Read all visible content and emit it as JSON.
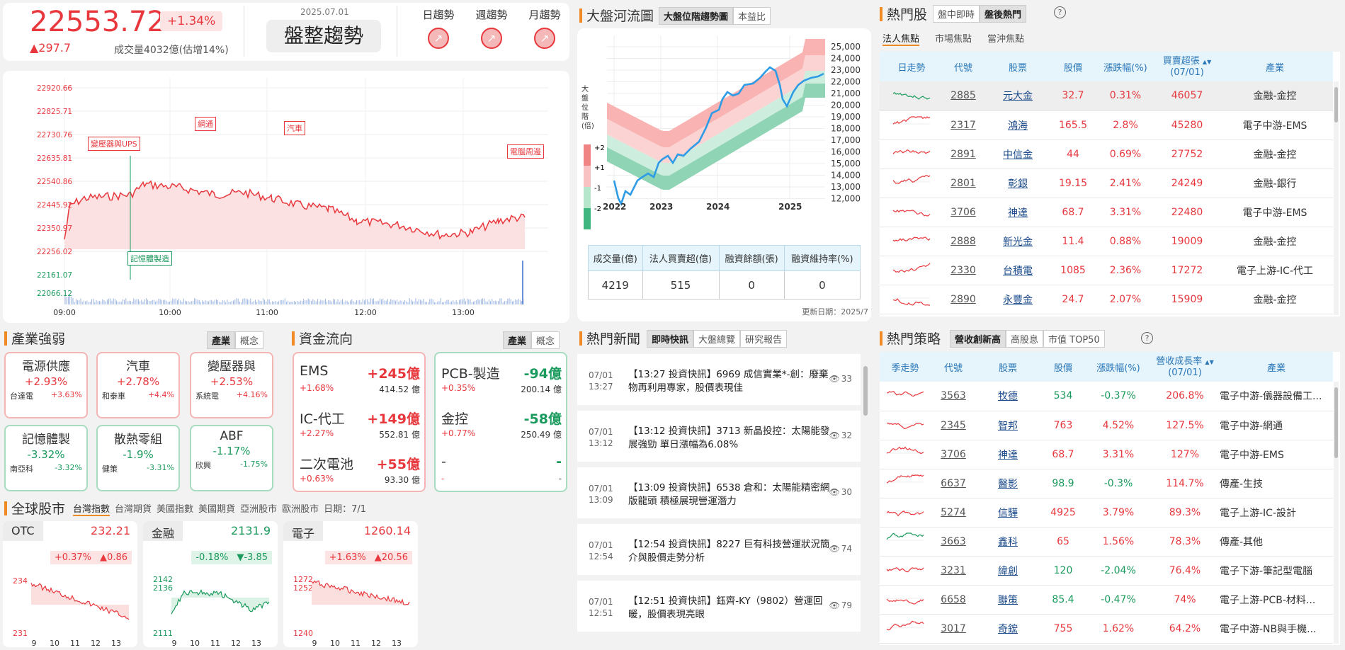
{
  "index": {
    "value": "22553.72",
    "pct": "+1.34%",
    "chg": "▲297.7",
    "volume": "成交量4032億(估增14%)",
    "date": "2025.07.01",
    "trend": "盤整趨勢",
    "trend_tabs": [
      "日趨勢",
      "週趨勢",
      "月趨勢"
    ]
  },
  "intraday": {
    "yticks": [
      "22920.66",
      "22825.71",
      "22730.76",
      "22635.81",
      "22540.86",
      "22445.92",
      "22350.97",
      "22256.02"
    ],
    "vticks": [
      "22161.07",
      "22066.12"
    ],
    "xticks": [
      "09:00",
      "10:00",
      "11:00",
      "12:00",
      "13:00"
    ],
    "tags": [
      "變壓器與UPS",
      "網通",
      "汽車",
      "電腦周邊",
      "記憶體製造"
    ]
  },
  "river": {
    "title": "大盤河流圖",
    "tabs": [
      "大盤位階趨勢圖",
      "本益比"
    ],
    "ylabel": "大盤位階(倍)",
    "bands": [
      "+2",
      "+1",
      "-1",
      "-2"
    ],
    "yticks": [
      "25,000",
      "24,000",
      "23,000",
      "22,000",
      "21,000",
      "20,000",
      "19,000",
      "18,000",
      "17,000",
      "16,000",
      "15,000",
      "14,000",
      "13,000",
      "12,000"
    ],
    "xticks": [
      "2022",
      "2023",
      "2024",
      "2025"
    ],
    "table_head": [
      "成交量(億)",
      "法人買賣超(億)",
      "融資餘額(張)",
      "融資維持率(%)"
    ],
    "table_vals": [
      "4219",
      "515",
      "0",
      "0"
    ],
    "updated": "更新日期：2025/7"
  },
  "hot": {
    "title": "熱門股",
    "tabs": [
      "盤中即時",
      "盤後熱門"
    ],
    "subtabs": [
      "法人焦點",
      "市場焦點",
      "當沖焦點"
    ],
    "head": [
      "日走勢",
      "代號",
      "股票",
      "股價",
      "漲跌幅(%)",
      "買賣超張",
      "(07/01)",
      "產業"
    ],
    "rows": [
      [
        "2885",
        "元大金",
        "32.7",
        "0.31%",
        "46057",
        "金融-金控"
      ],
      [
        "2317",
        "鴻海",
        "165.5",
        "2.8%",
        "45280",
        "電子中游-EMS"
      ],
      [
        "2891",
        "中信金",
        "44",
        "0.69%",
        "27752",
        "金融-金控"
      ],
      [
        "2801",
        "彰銀",
        "19.15",
        "2.41%",
        "24249",
        "金融-銀行"
      ],
      [
        "3706",
        "神達",
        "68.7",
        "3.31%",
        "22480",
        "電子中游-EMS"
      ],
      [
        "2888",
        "新光金",
        "11.4",
        "0.88%",
        "19009",
        "金融-金控"
      ],
      [
        "2330",
        "台積電",
        "1085",
        "2.36%",
        "17272",
        "電子上游-IC-代工"
      ],
      [
        "2890",
        "永豐金",
        "24.7",
        "2.07%",
        "15909",
        "金融-金控"
      ]
    ]
  },
  "strategy": {
    "title": "熱門策略",
    "tabs": [
      "營收創新高",
      "高股息",
      "市值 TOP50"
    ],
    "head": [
      "季走勢",
      "代號",
      "股票",
      "股價",
      "漲跌幅(%)",
      "營收成長率",
      "(07/01)",
      "產業"
    ],
    "rows": [
      [
        "3563",
        "牧德",
        "534",
        "-0.37%",
        "206.8%",
        "電子中游-儀器設備工..."
      ],
      [
        "2345",
        "智邦",
        "763",
        "4.52%",
        "127.5%",
        "電子中游-網通"
      ],
      [
        "3706",
        "神達",
        "68.7",
        "3.31%",
        "127%",
        "電子中游-EMS"
      ],
      [
        "6637",
        "醫影",
        "98.9",
        "-0.3%",
        "114.7%",
        "傳產-生技"
      ],
      [
        "5274",
        "信驊",
        "4925",
        "3.79%",
        "89.3%",
        "電子上游-IC-設計"
      ],
      [
        "3663",
        "鑫科",
        "65",
        "1.56%",
        "78.3%",
        "傳產-其他"
      ],
      [
        "3231",
        "緯創",
        "120",
        "-2.04%",
        "76.4%",
        "電子下游-筆記型電腦"
      ],
      [
        "6658",
        "聯策",
        "85.4",
        "-0.47%",
        "74%",
        "電子上游-PCB-材料..."
      ],
      [
        "3017",
        "奇鋐",
        "755",
        "1.62%",
        "64.2%",
        "電子中游-NB與手機..."
      ]
    ]
  },
  "industry": {
    "title": "產業強弱",
    "tabs": [
      "產業",
      "概念"
    ],
    "boxes": [
      {
        "t": "電源供應",
        "p": "+2.93%",
        "s1": "台達電",
        "s2": "+3.63%",
        "c": "r"
      },
      {
        "t": "汽車",
        "p": "+2.78%",
        "s1": "和泰車",
        "s2": "+4.4%",
        "c": "r"
      },
      {
        "t": "變壓器與",
        "p": "+2.53%",
        "s1": "系統電",
        "s2": "+4.16%",
        "c": "r"
      },
      {
        "t": "記憶體製",
        "p": "-3.32%",
        "s1": "南亞科",
        "s2": "-3.32%",
        "c": "g"
      },
      {
        "t": "散熱零組",
        "p": "-1.9%",
        "s1": "健策",
        "s2": "-3.31%",
        "c": "g"
      },
      {
        "t": "ABF",
        "p": "-1.17%",
        "s1": "欣興",
        "s2": "-1.75%",
        "c": "g"
      }
    ]
  },
  "flow": {
    "title": "資金流向",
    "tabs": [
      "產業",
      "概念"
    ],
    "left": [
      {
        "n": "EMS",
        "v": "+245億",
        "p": "+1.68%",
        "a": "414.52 億"
      },
      {
        "n": "IC-代工",
        "v": "+149億",
        "p": "+2.27%",
        "a": "552.81 億"
      },
      {
        "n": "二次電池",
        "v": "+55億",
        "p": "+0.63%",
        "a": "93.30 億"
      }
    ],
    "right": [
      {
        "n": "PCB-製造",
        "v": "-94億",
        "p": "+0.35%",
        "a": "200.14 億"
      },
      {
        "n": "金控",
        "v": "-58億",
        "p": "+0.77%",
        "a": "250.49 億"
      },
      {
        "n": "-",
        "v": "-",
        "p": "-",
        "a": "-"
      }
    ]
  },
  "news": {
    "title": "熱門新聞",
    "tabs": [
      "即時快訊",
      "大盤總覽",
      "研究報告"
    ],
    "items": [
      {
        "d": "07/01",
        "t": "13:27",
        "x": "【13:27 投資快訊】6969 成信實業*-創：廢棄物再利用專家，股價表現佳",
        "v": "33"
      },
      {
        "d": "07/01",
        "t": "13:12",
        "x": "【13:12 投資快訊】3713 新晶投控：太陽能發展強勁 單日漲幅為6.08%",
        "v": "32"
      },
      {
        "d": "07/01",
        "t": "13:09",
        "x": "【13:09 投資快訊】6538 倉和：太陽能精密網版龍頭 積極展現營運潛力",
        "v": "30"
      },
      {
        "d": "07/01",
        "t": "12:54",
        "x": "【12:54 投資快訊】8227 巨有科技營運狀況簡介與股價走勢分析",
        "v": "74"
      },
      {
        "d": "07/01",
        "t": "12:51",
        "x": "【12:51 投資快訊】鈺齊-KY（9802）營運回暖，股價表現亮眼",
        "v": "79"
      }
    ]
  },
  "global": {
    "title": "全球股市",
    "tabs": [
      "台灣指數",
      "台灣期貨",
      "美國指數",
      "美國期貨",
      "亞洲股市",
      "歐洲股市"
    ],
    "date": "日期：7/1",
    "cards": [
      {
        "n": "OTC",
        "v": "232.21",
        "p": "+0.37%",
        "c": "▲0.86",
        "yt": [
          "234",
          "231"
        ],
        "color": "up"
      },
      {
        "n": "金融",
        "v": "2131.9",
        "p": "-0.18%",
        "c": "▼-3.85",
        "yt": [
          "2142",
          "2136",
          "2111"
        ],
        "color": "dn"
      },
      {
        "n": "電子",
        "v": "1260.14",
        "p": "+1.63%",
        "c": "▲20.56",
        "yt": [
          "1272",
          "1252",
          "1240"
        ],
        "color": "up"
      }
    ],
    "xt": [
      "9",
      "10",
      "11",
      "12",
      "13"
    ]
  }
}
